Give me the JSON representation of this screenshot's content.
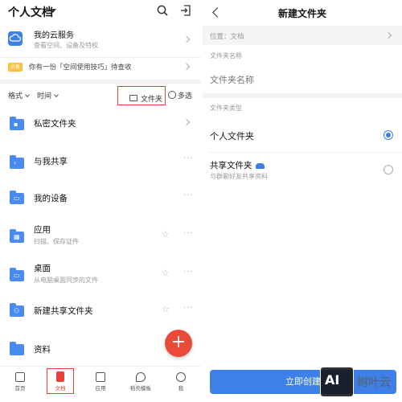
{
  "left": {
    "header": {
      "title": "个人文档"
    },
    "cloud": {
      "title": "我的云服务",
      "subtitle": "查看空间、设备及特权"
    },
    "tip": {
      "badge": "必备",
      "text": "你有一份「空间使用技巧」待查收"
    },
    "toolbar": {
      "format": "格式",
      "time": "时间",
      "folder": "文件夹",
      "multi": "多选"
    },
    "items": [
      {
        "title": "私密文件夹",
        "subtitle": "",
        "icon": "lock-icon",
        "glyph": "🔒"
      },
      {
        "title": "与我共享",
        "subtitle": "",
        "icon": "share-icon",
        "glyph": "<"
      },
      {
        "title": "我的设备",
        "subtitle": "",
        "icon": "device-icon",
        "glyph": "▭"
      },
      {
        "title": "应用",
        "subtitle": "扫描、保存证件",
        "icon": "apps-icon",
        "glyph": "▦"
      },
      {
        "title": "桌面",
        "subtitle": "从电脑桌面同步的文件",
        "icon": "desktop-icon",
        "glyph": "▭"
      },
      {
        "title": "新建共享文件夹",
        "subtitle": "",
        "icon": "shared-folder-icon",
        "glyph": "⚇"
      },
      {
        "title": "资料",
        "subtitle": "",
        "icon": "folder-icon",
        "glyph": ""
      }
    ],
    "fab": "+",
    "tabs": [
      {
        "label": "首页"
      },
      {
        "label": "文档"
      },
      {
        "label": "应用"
      },
      {
        "label": "稻壳模板"
      },
      {
        "label": "我"
      }
    ]
  },
  "right": {
    "title": "新建文件夹",
    "location": "位置：文档",
    "name_label": "文件夹名称",
    "name_placeholder": "文件夹名称",
    "type_label": "文件夹类型",
    "option_personal": "个人文件夹",
    "option_shared": "共享文件夹",
    "option_shared_desc": "与群聊好友共享资料",
    "selected": "个人文件夹",
    "create_button": "立即创建"
  },
  "watermark": {
    "logo": "AI",
    "text": "树叶云"
  },
  "colors": {
    "accent": "#3f7fe8",
    "highlight": "#e8403a",
    "fab": "#ea4b39"
  }
}
